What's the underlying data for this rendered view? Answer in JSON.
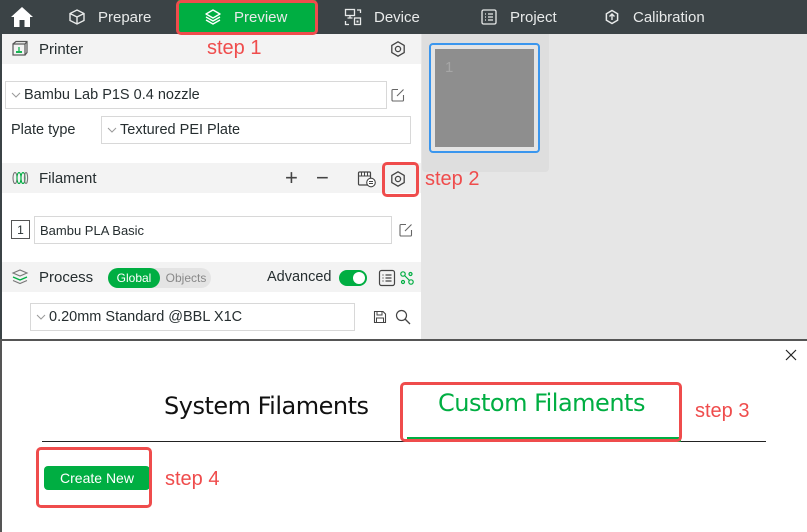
{
  "topbar": {
    "tabs": [
      {
        "label": "Prepare",
        "icon": "cube-icon"
      },
      {
        "label": "Preview",
        "icon": "layers-icon",
        "active": true
      },
      {
        "label": "Device",
        "icon": "device-icon"
      },
      {
        "label": "Project",
        "icon": "project-list-icon"
      },
      {
        "label": "Calibration",
        "icon": "calibration-icon"
      }
    ]
  },
  "printer": {
    "title": "Printer",
    "preset": "Bambu Lab P1S 0.4 nozzle",
    "plate_type_label": "Plate type",
    "plate_type": "Textured PEI Plate"
  },
  "filament": {
    "title": "Filament",
    "add_label": "+",
    "remove_label": "−",
    "items": [
      {
        "index": "1",
        "name": "Bambu PLA Basic"
      }
    ]
  },
  "process": {
    "title": "Process",
    "scope_options": [
      "Global",
      "Objects"
    ],
    "scope_selected": "Global",
    "advanced_label": "Advanced",
    "advanced_on": true,
    "preset": "0.20mm Standard @BBL X1C"
  },
  "plate": {
    "number": "1"
  },
  "dialog": {
    "tabs": [
      "System Filaments",
      "Custom Filaments"
    ],
    "active_tab": "Custom Filaments",
    "create_button": "Create New",
    "close_label": "×"
  },
  "annotations": {
    "step1": "step 1",
    "step2": "step 2",
    "step3": "step 3",
    "step4": "step 4",
    "color": "#ef4c4c"
  },
  "colors": {
    "accent": "#00ae42",
    "topbar": "#3b4346",
    "selection": "#3a96ee"
  }
}
